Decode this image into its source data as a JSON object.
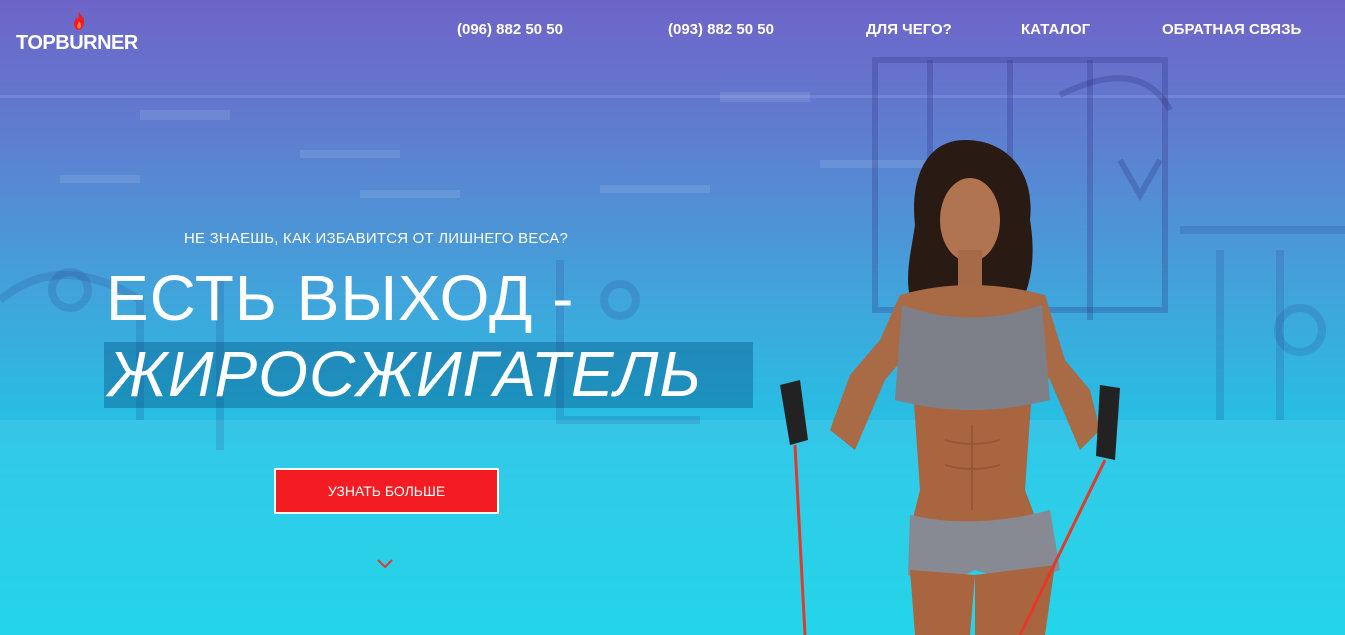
{
  "header": {
    "logo": "TOPBURNER",
    "nav": [
      {
        "label": "(096) 882 50 50"
      },
      {
        "label": "(093) 882 50 50"
      },
      {
        "label": "ДЛЯ ЧЕГО?"
      },
      {
        "label": "КАТАЛОГ"
      },
      {
        "label": "ОБРАТНАЯ СВЯЗЬ"
      }
    ]
  },
  "hero": {
    "subtitle": "НЕ ЗНАЕШЬ, КАК ИЗБАВИТСЯ ОТ ЛИШНЕГО ВЕСА?",
    "headline": "ЕСТЬ ВЫХОД -",
    "highlight": "ЖИРОСЖИГАТЕЛЬ",
    "cta_label": "УЗНАТЬ БОЛЬШЕ"
  },
  "colors": {
    "accent": "#f21c22",
    "gradient_top": "#6e64c8",
    "gradient_bottom": "#12d2e8"
  },
  "icons": {
    "logo_flame": "flame-icon",
    "scroll": "chevron-down-icon"
  }
}
